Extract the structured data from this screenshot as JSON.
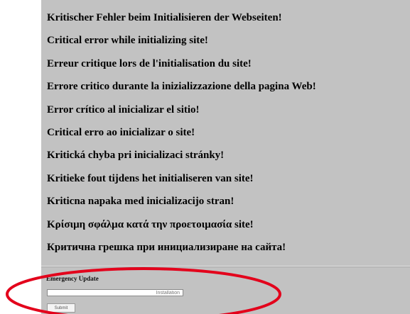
{
  "messages": [
    "Kritischer Fehler beim Initialisieren der Webseiten!",
    "Critical error while initializing site!",
    "Erreur critique lors de l'initialisation du site!",
    "Errore critico durante la inizializzazione della pagina Web!",
    "Error crítico al inicializar el sitio!",
    "Critical erro ao inicializar o site!",
    "Kritická chyba pri inicializaci stránky!",
    "Kritieke fout tijdens het initialiseren van site!",
    "Kriticna napaka med inicializacijo stran!",
    "Κρίσιμη σφάλμα κατά την προετοιμασία site!",
    "Критична грешка при инициализиране на сайта!"
  ],
  "emergency_update": {
    "title": "Emergency Update",
    "input_text": "Installation",
    "button_label": "Submit"
  },
  "colors": {
    "panel_background": "#c2c2c2",
    "annotation": "#e3001b"
  }
}
